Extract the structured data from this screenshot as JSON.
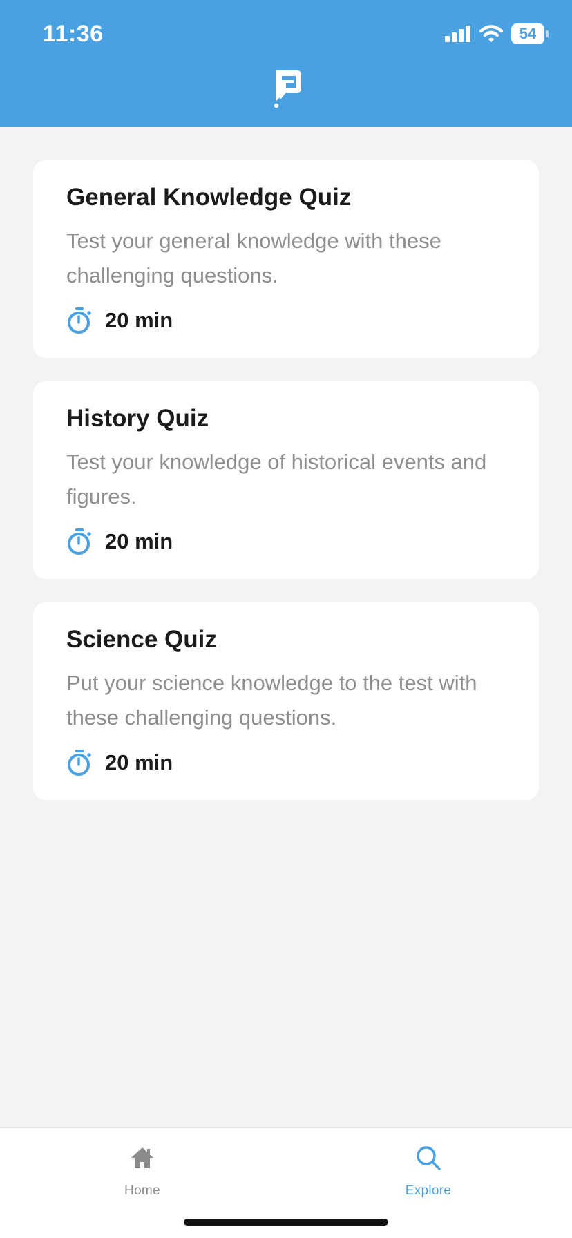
{
  "status_bar": {
    "time": "11:36",
    "battery": "54"
  },
  "header": {
    "logo_icon": "flag-p-logo"
  },
  "colors": {
    "accent": "#4aa1e2",
    "background": "#f3f3f3",
    "card": "#ffffff",
    "title_text": "#1b1b1b",
    "description_text": "#8e8e8e",
    "inactive_tab": "#8a8a8a"
  },
  "quizzes": [
    {
      "title": "General Knowledge Quiz",
      "description": "Test your general knowledge with these challenging questions.",
      "duration": "20 min",
      "icon": "stopwatch-icon"
    },
    {
      "title": "History Quiz",
      "description": "Test your knowledge of historical events and figures.",
      "duration": "20 min",
      "icon": "stopwatch-icon"
    },
    {
      "title": "Science Quiz",
      "description": "Put your science knowledge to the test with these challenging questions.",
      "duration": "20 min",
      "icon": "stopwatch-icon"
    }
  ],
  "tabbar": {
    "items": [
      {
        "label": "Home",
        "icon": "home-icon",
        "active": false
      },
      {
        "label": "Explore",
        "icon": "search-icon",
        "active": true
      }
    ]
  }
}
